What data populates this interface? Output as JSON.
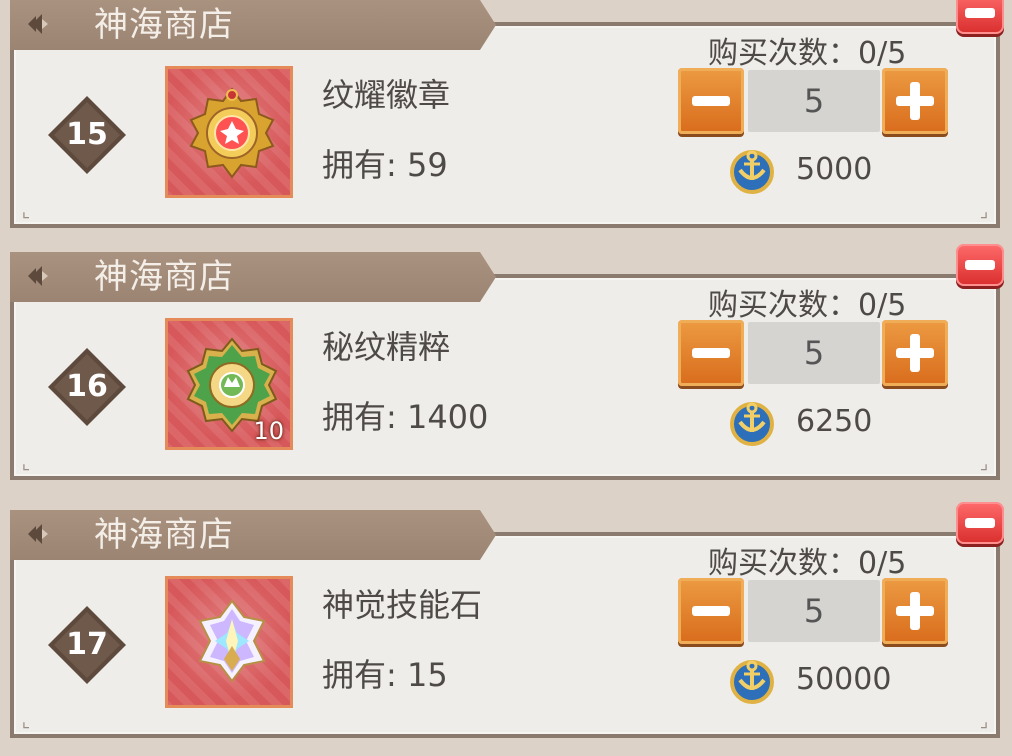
{
  "shop_items": [
    {
      "shop_name": "神海商店",
      "rank": "15",
      "item_name": "纹耀徽章",
      "owned": "拥有: 59",
      "quantity_label": "",
      "purchase_count": "购买次数：0/5",
      "stepper_value": "5",
      "price": "5000",
      "icon": "gold-red-emblem-icon",
      "currency_icon": "anchor-coin-icon"
    },
    {
      "shop_name": "神海商店",
      "rank": "16",
      "item_name": "秘纹精粹",
      "owned": "拥有: 1400",
      "quantity_label": "10",
      "purchase_count": "购买次数：0/5",
      "stepper_value": "5",
      "price": "6250",
      "icon": "green-gold-medal-icon",
      "currency_icon": "anchor-coin-icon"
    },
    {
      "shop_name": "神海商店",
      "rank": "17",
      "item_name": "神觉技能石",
      "owned": "拥有: 15",
      "quantity_label": "",
      "purchase_count": "购买次数：0/5",
      "stepper_value": "5",
      "price": "50000",
      "icon": "rainbow-crystal-cross-icon",
      "currency_icon": "anchor-coin-icon"
    }
  ],
  "colors": {
    "banner": "#9b8472",
    "card_border": "#8b7b6f",
    "stepper_button": "#d96c1c",
    "remove_button": "#d92d2d",
    "item_background": "#d7585a"
  }
}
